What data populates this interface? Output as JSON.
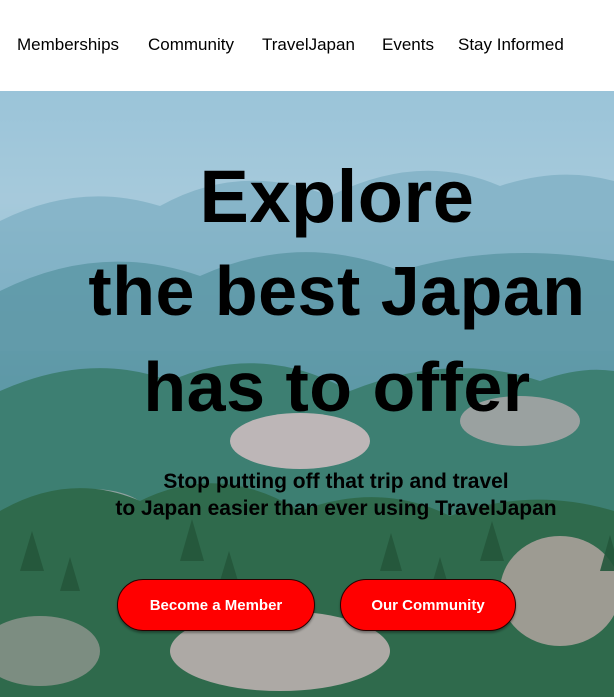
{
  "nav": {
    "items": [
      "Memberships",
      "Community",
      "TravelJapan",
      "Events",
      "Stay Informed"
    ]
  },
  "hero": {
    "headline": [
      "Explore",
      "the best Japan",
      "has to offer"
    ],
    "subtitle": [
      "Stop putting off that trip and travel",
      "to Japan easier than ever using TravelJapan"
    ],
    "primary_button": "Become a Member",
    "secondary_button": "Our Community",
    "button_color": "#ff0000"
  }
}
